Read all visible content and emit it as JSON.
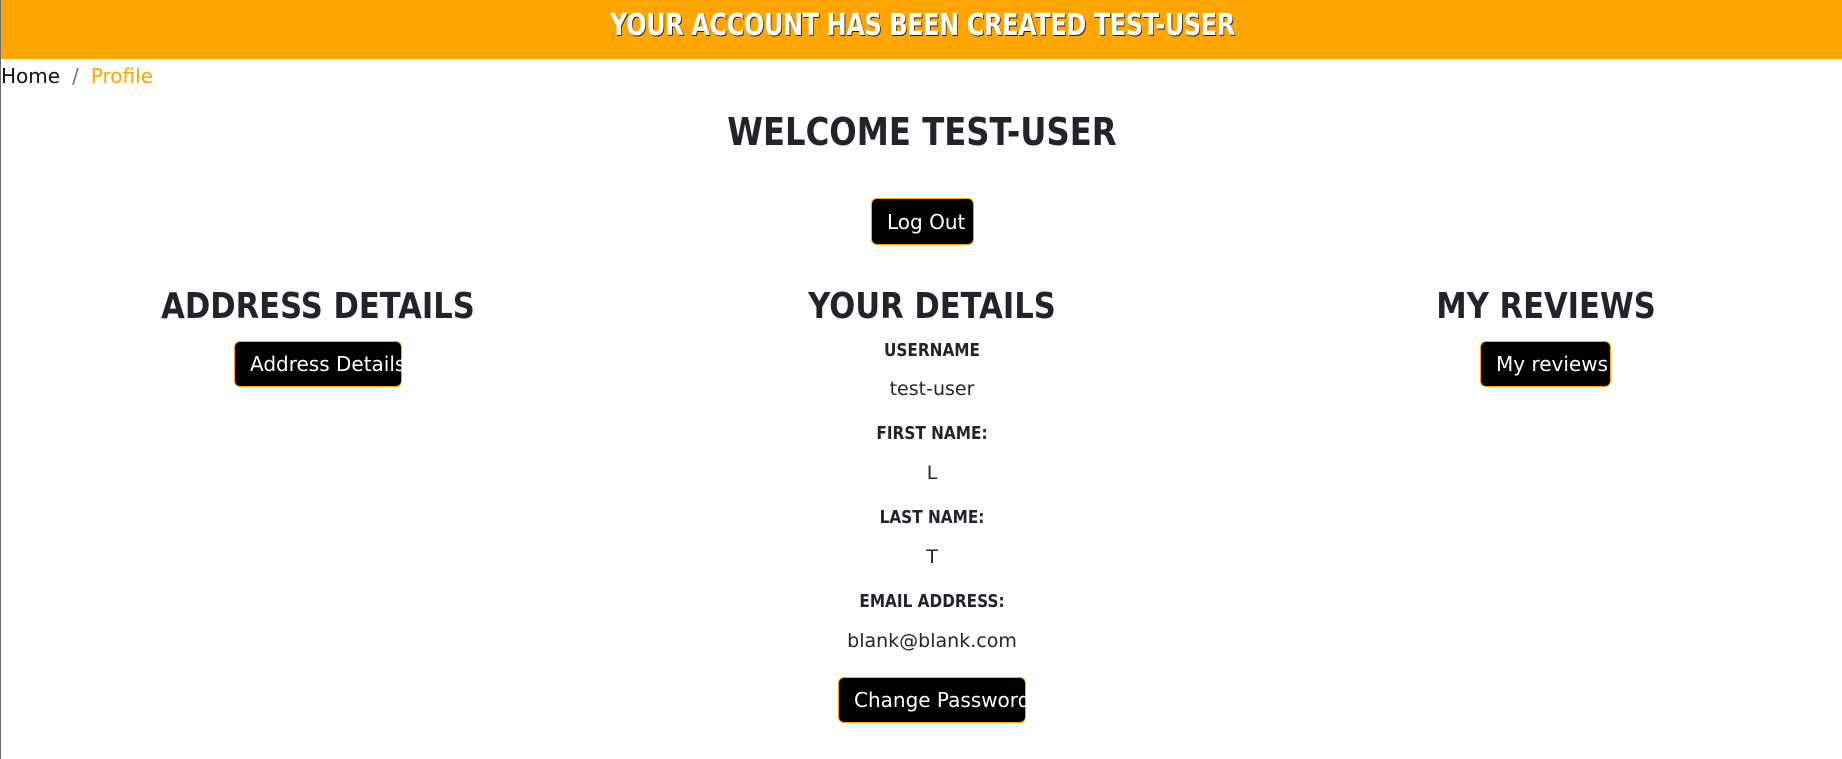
{
  "banner": {
    "message": "Your account has been created test-user"
  },
  "breadcrumb": {
    "home": "Home",
    "separator": "/",
    "current": "Profile"
  },
  "welcome": {
    "title": "Welcome test-user",
    "logout_label": "Log Out"
  },
  "address": {
    "heading": "Address Details",
    "button_label": "Address Details"
  },
  "details": {
    "heading": "Your Details",
    "username_label": "Username",
    "username_value": "test-user",
    "first_name_label": "First Name:",
    "first_name_value": "L",
    "last_name_label": "Last Name:",
    "last_name_value": "T",
    "email_label": "Email Address:",
    "email_value": "blank@blank.com",
    "change_password_label": "Change Password"
  },
  "reviews": {
    "heading": "My Reviews",
    "button_label": "My reviews"
  },
  "colors": {
    "accent": "#ffa500",
    "button_bg": "#000000",
    "text": "#212529"
  }
}
